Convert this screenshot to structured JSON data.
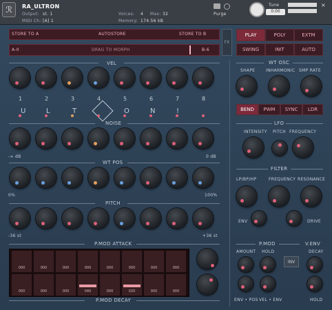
{
  "header": {
    "instrument": "RA_ULTRON",
    "output_label": "Output:",
    "output_value": "st. 1",
    "midi_label": "MIDI Ch:",
    "midi_value": "[A] 1",
    "voices_label": "Voices:",
    "voices_value": "4",
    "max_label": "Max:",
    "max_value": "32",
    "memory_label": "Memory:",
    "memory_value": "174.56 kB",
    "purge": "Purge",
    "tune_label": "Tune",
    "tune_value": "0.00"
  },
  "snapshot": {
    "store_a": "STORE TO A",
    "autostore": "AUTOSTORE",
    "store_b": "STORE TO B",
    "morph_a": "A-0",
    "morph_center": "DRAG TO MORPH",
    "morph_b": "B-6",
    "fx": "FX"
  },
  "modes": {
    "play": "PLAY",
    "poly": "POLY",
    "extm": "EXTM",
    "swing": "SWING",
    "init": "INIT",
    "auto": "AUTO"
  },
  "sections": {
    "vel": "VEL",
    "noise": "NOISE",
    "wtpos": "WT POS",
    "pitch": "PITCH",
    "pmod_attack": "P.MOD ATTACK",
    "pmod_decay": "P.MOD DECAY"
  },
  "steps": [
    "1",
    "2",
    "3",
    "4",
    "5",
    "6",
    "7",
    "8"
  ],
  "letters": [
    "U",
    "L",
    "T",
    "O",
    "N",
    "!"
  ],
  "noise_min": "-∞ dB",
  "noise_max": "0 dB",
  "wt_min": "0%",
  "wt_max": "100%",
  "pitch_min": "-36 st",
  "pitch_max": "+36 st",
  "attack_values": [
    "000",
    "000",
    "000",
    "000",
    "000",
    "000",
    "000",
    "000"
  ],
  "decay_values": [
    "000",
    "000",
    "000",
    "040",
    "000",
    "020",
    "000",
    "000"
  ],
  "wtosc": {
    "title": "WT OSC",
    "shape": "SHAPE",
    "inharmonic": "INHARMONIC",
    "smp_rate": "SMP RATE",
    "bend": "BEND",
    "pwm": "PWM",
    "sync": "SYNC",
    "ldr": "LDR"
  },
  "lfo": {
    "title": "LFO",
    "intensity": "INTENSITY",
    "pitch": "PITCH",
    "frequency": "FREQUENCY"
  },
  "filter": {
    "title": "FILTER",
    "mode": "LP/BP/HP",
    "frequency": "FREQUENCY",
    "resonance": "RESONANCE",
    "env": "ENV",
    "drive": "DRIVE"
  },
  "pmod": {
    "title": "P.MOD",
    "amount": "AMOUNT",
    "hold": "HOLD",
    "inv": "INV",
    "env_pos": "ENV • POS",
    "vel_env": "VEL • ENV"
  },
  "venv": {
    "title": "V.ENV",
    "decay": "DECAY",
    "hold": "HOLD"
  }
}
